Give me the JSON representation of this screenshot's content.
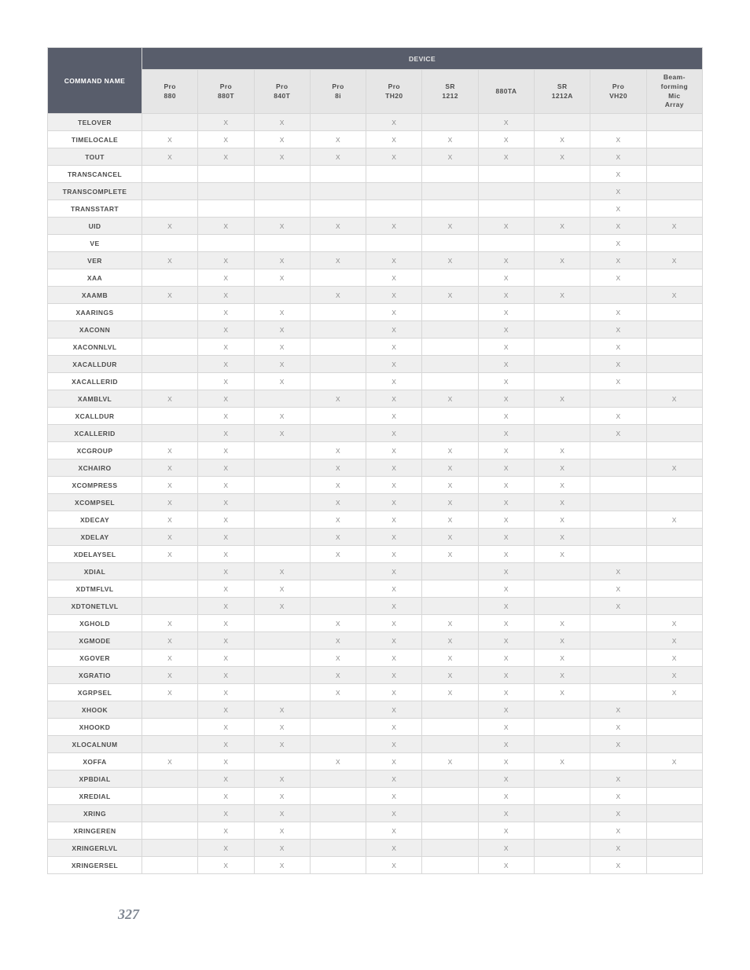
{
  "header": {
    "row_label": "COMMAND NAME",
    "device_label": "DEVICE",
    "columns": [
      "Pro 880",
      "Pro 880T",
      "Pro 840T",
      "Pro 8i",
      "Pro TH20",
      "SR 1212",
      "880TA",
      "SR 1212A",
      "Pro VH20",
      "Beam- forming Mic Array"
    ]
  },
  "rows": [
    {
      "name": "TELOVER",
      "marks": [
        "",
        "X",
        "X",
        "",
        "X",
        "",
        "X",
        "",
        "",
        ""
      ]
    },
    {
      "name": "TIMELOCALE",
      "marks": [
        "X",
        "X",
        "X",
        "X",
        "X",
        "X",
        "X",
        "X",
        "X",
        ""
      ]
    },
    {
      "name": "TOUT",
      "marks": [
        "X",
        "X",
        "X",
        "X",
        "X",
        "X",
        "X",
        "X",
        "X",
        ""
      ]
    },
    {
      "name": "TRANSCANCEL",
      "marks": [
        "",
        "",
        "",
        "",
        "",
        "",
        "",
        "",
        "X",
        ""
      ]
    },
    {
      "name": "TRANSCOMPLETE",
      "marks": [
        "",
        "",
        "",
        "",
        "",
        "",
        "",
        "",
        "X",
        ""
      ]
    },
    {
      "name": "TRANSSTART",
      "marks": [
        "",
        "",
        "",
        "",
        "",
        "",
        "",
        "",
        "X",
        ""
      ]
    },
    {
      "name": "UID",
      "marks": [
        "X",
        "X",
        "X",
        "X",
        "X",
        "X",
        "X",
        "X",
        "X",
        "X"
      ]
    },
    {
      "name": "VE",
      "marks": [
        "",
        "",
        "",
        "",
        "",
        "",
        "",
        "",
        "X",
        ""
      ]
    },
    {
      "name": "VER",
      "marks": [
        "X",
        "X",
        "X",
        "X",
        "X",
        "X",
        "X",
        "X",
        "X",
        "X"
      ]
    },
    {
      "name": "XAA",
      "marks": [
        "",
        "X",
        "X",
        "",
        "X",
        "",
        "X",
        "",
        "X",
        ""
      ]
    },
    {
      "name": "XAAMB",
      "marks": [
        "X",
        "X",
        "",
        "X",
        "X",
        "X",
        "X",
        "X",
        "",
        "X"
      ]
    },
    {
      "name": "XAARINGS",
      "marks": [
        "",
        "X",
        "X",
        "",
        "X",
        "",
        "X",
        "",
        "X",
        ""
      ]
    },
    {
      "name": "XACONN",
      "marks": [
        "",
        "X",
        "X",
        "",
        "X",
        "",
        "X",
        "",
        "X",
        ""
      ]
    },
    {
      "name": "XACONNLVL",
      "marks": [
        "",
        "X",
        "X",
        "",
        "X",
        "",
        "X",
        "",
        "X",
        ""
      ]
    },
    {
      "name": "XACALLDUR",
      "marks": [
        "",
        "X",
        "X",
        "",
        "X",
        "",
        "X",
        "",
        "X",
        ""
      ]
    },
    {
      "name": "XACALLERID",
      "marks": [
        "",
        "X",
        "X",
        "",
        "X",
        "",
        "X",
        "",
        "X",
        ""
      ]
    },
    {
      "name": "XAMBLVL",
      "marks": [
        "X",
        "X",
        "",
        "X",
        "X",
        "X",
        "X",
        "X",
        "",
        "X"
      ]
    },
    {
      "name": "XCALLDUR",
      "marks": [
        "",
        "X",
        "X",
        "",
        "X",
        "",
        "X",
        "",
        "X",
        ""
      ]
    },
    {
      "name": "XCALLERID",
      "marks": [
        "",
        "X",
        "X",
        "",
        "X",
        "",
        "X",
        "",
        "X",
        ""
      ]
    },
    {
      "name": "XCGROUP",
      "marks": [
        "X",
        "X",
        "",
        "X",
        "X",
        "X",
        "X",
        "X",
        "",
        ""
      ]
    },
    {
      "name": "XCHAIRO",
      "marks": [
        "X",
        "X",
        "",
        "X",
        "X",
        "X",
        "X",
        "X",
        "",
        "X"
      ]
    },
    {
      "name": "XCOMPRESS",
      "marks": [
        "X",
        "X",
        "",
        "X",
        "X",
        "X",
        "X",
        "X",
        "",
        ""
      ]
    },
    {
      "name": "XCOMPSEL",
      "marks": [
        "X",
        "X",
        "",
        "X",
        "X",
        "X",
        "X",
        "X",
        "",
        ""
      ]
    },
    {
      "name": "XDECAY",
      "marks": [
        "X",
        "X",
        "",
        "X",
        "X",
        "X",
        "X",
        "X",
        "",
        "X"
      ]
    },
    {
      "name": "XDELAY",
      "marks": [
        "X",
        "X",
        "",
        "X",
        "X",
        "X",
        "X",
        "X",
        "",
        ""
      ]
    },
    {
      "name": "XDELAYSEL",
      "marks": [
        "X",
        "X",
        "",
        "X",
        "X",
        "X",
        "X",
        "X",
        "",
        ""
      ]
    },
    {
      "name": "XDIAL",
      "marks": [
        "",
        "X",
        "X",
        "",
        "X",
        "",
        "X",
        "",
        "X",
        ""
      ]
    },
    {
      "name": "XDTMFLVL",
      "marks": [
        "",
        "X",
        "X",
        "",
        "X",
        "",
        "X",
        "",
        "X",
        ""
      ]
    },
    {
      "name": "XDTONETLVL",
      "marks": [
        "",
        "X",
        "X",
        "",
        "X",
        "",
        "X",
        "",
        "X",
        ""
      ]
    },
    {
      "name": "XGHOLD",
      "marks": [
        "X",
        "X",
        "",
        "X",
        "X",
        "X",
        "X",
        "X",
        "",
        "X"
      ]
    },
    {
      "name": "XGMODE",
      "marks": [
        "X",
        "X",
        "",
        "X",
        "X",
        "X",
        "X",
        "X",
        "",
        "X"
      ]
    },
    {
      "name": "XGOVER",
      "marks": [
        "X",
        "X",
        "",
        "X",
        "X",
        "X",
        "X",
        "X",
        "",
        "X"
      ]
    },
    {
      "name": "XGRATIO",
      "marks": [
        "X",
        "X",
        "",
        "X",
        "X",
        "X",
        "X",
        "X",
        "",
        "X"
      ]
    },
    {
      "name": "XGRPSEL",
      "marks": [
        "X",
        "X",
        "",
        "X",
        "X",
        "X",
        "X",
        "X",
        "",
        "X"
      ]
    },
    {
      "name": "XHOOK",
      "marks": [
        "",
        "X",
        "X",
        "",
        "X",
        "",
        "X",
        "",
        "X",
        ""
      ]
    },
    {
      "name": "XHOOKD",
      "marks": [
        "",
        "X",
        "X",
        "",
        "X",
        "",
        "X",
        "",
        "X",
        ""
      ]
    },
    {
      "name": "XLOCALNUM",
      "marks": [
        "",
        "X",
        "X",
        "",
        "X",
        "",
        "X",
        "",
        "X",
        ""
      ]
    },
    {
      "name": "XOFFA",
      "marks": [
        "X",
        "X",
        "",
        "X",
        "X",
        "X",
        "X",
        "X",
        "",
        "X"
      ]
    },
    {
      "name": "XPBDIAL",
      "marks": [
        "",
        "X",
        "X",
        "",
        "X",
        "",
        "X",
        "",
        "X",
        ""
      ]
    },
    {
      "name": "XREDIAL",
      "marks": [
        "",
        "X",
        "X",
        "",
        "X",
        "",
        "X",
        "",
        "X",
        ""
      ]
    },
    {
      "name": "XRING",
      "marks": [
        "",
        "X",
        "X",
        "",
        "X",
        "",
        "X",
        "",
        "X",
        ""
      ]
    },
    {
      "name": "XRINGEREN",
      "marks": [
        "",
        "X",
        "X",
        "",
        "X",
        "",
        "X",
        "",
        "X",
        ""
      ]
    },
    {
      "name": "XRINGERLVL",
      "marks": [
        "",
        "X",
        "X",
        "",
        "X",
        "",
        "X",
        "",
        "X",
        ""
      ]
    },
    {
      "name": "XRINGERSEL",
      "marks": [
        "",
        "X",
        "X",
        "",
        "X",
        "",
        "X",
        "",
        "X",
        ""
      ]
    }
  ],
  "page_number": "327"
}
